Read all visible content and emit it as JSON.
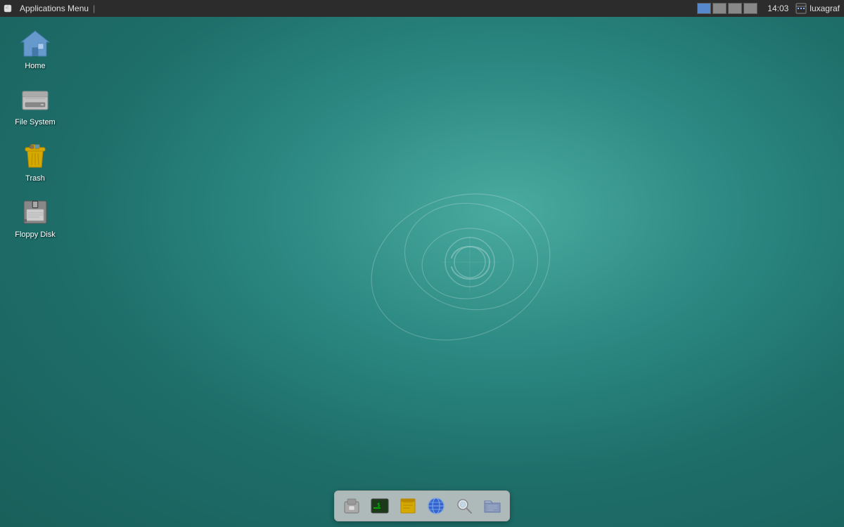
{
  "panel": {
    "apps_menu_label": "Applications Menu",
    "time": "14:03",
    "username": "luxagraf",
    "workspaces": [
      {
        "id": 1,
        "active": true
      },
      {
        "id": 2,
        "active": false
      },
      {
        "id": 3,
        "active": false
      },
      {
        "id": 4,
        "active": false
      }
    ]
  },
  "desktop_icons": [
    {
      "id": "home",
      "label": "Home",
      "type": "home"
    },
    {
      "id": "filesystem",
      "label": "File System",
      "type": "filesystem"
    },
    {
      "id": "trash",
      "label": "Trash",
      "type": "trash"
    },
    {
      "id": "floppy",
      "label": "Floppy Disk",
      "type": "floppy"
    }
  ],
  "taskbar_items": [
    {
      "id": "removable",
      "label": "Removable Media"
    },
    {
      "id": "terminal",
      "label": "Terminal"
    },
    {
      "id": "notes",
      "label": "Notes"
    },
    {
      "id": "browser",
      "label": "Web Browser"
    },
    {
      "id": "search",
      "label": "Search"
    },
    {
      "id": "files",
      "label": "File Manager"
    }
  ]
}
